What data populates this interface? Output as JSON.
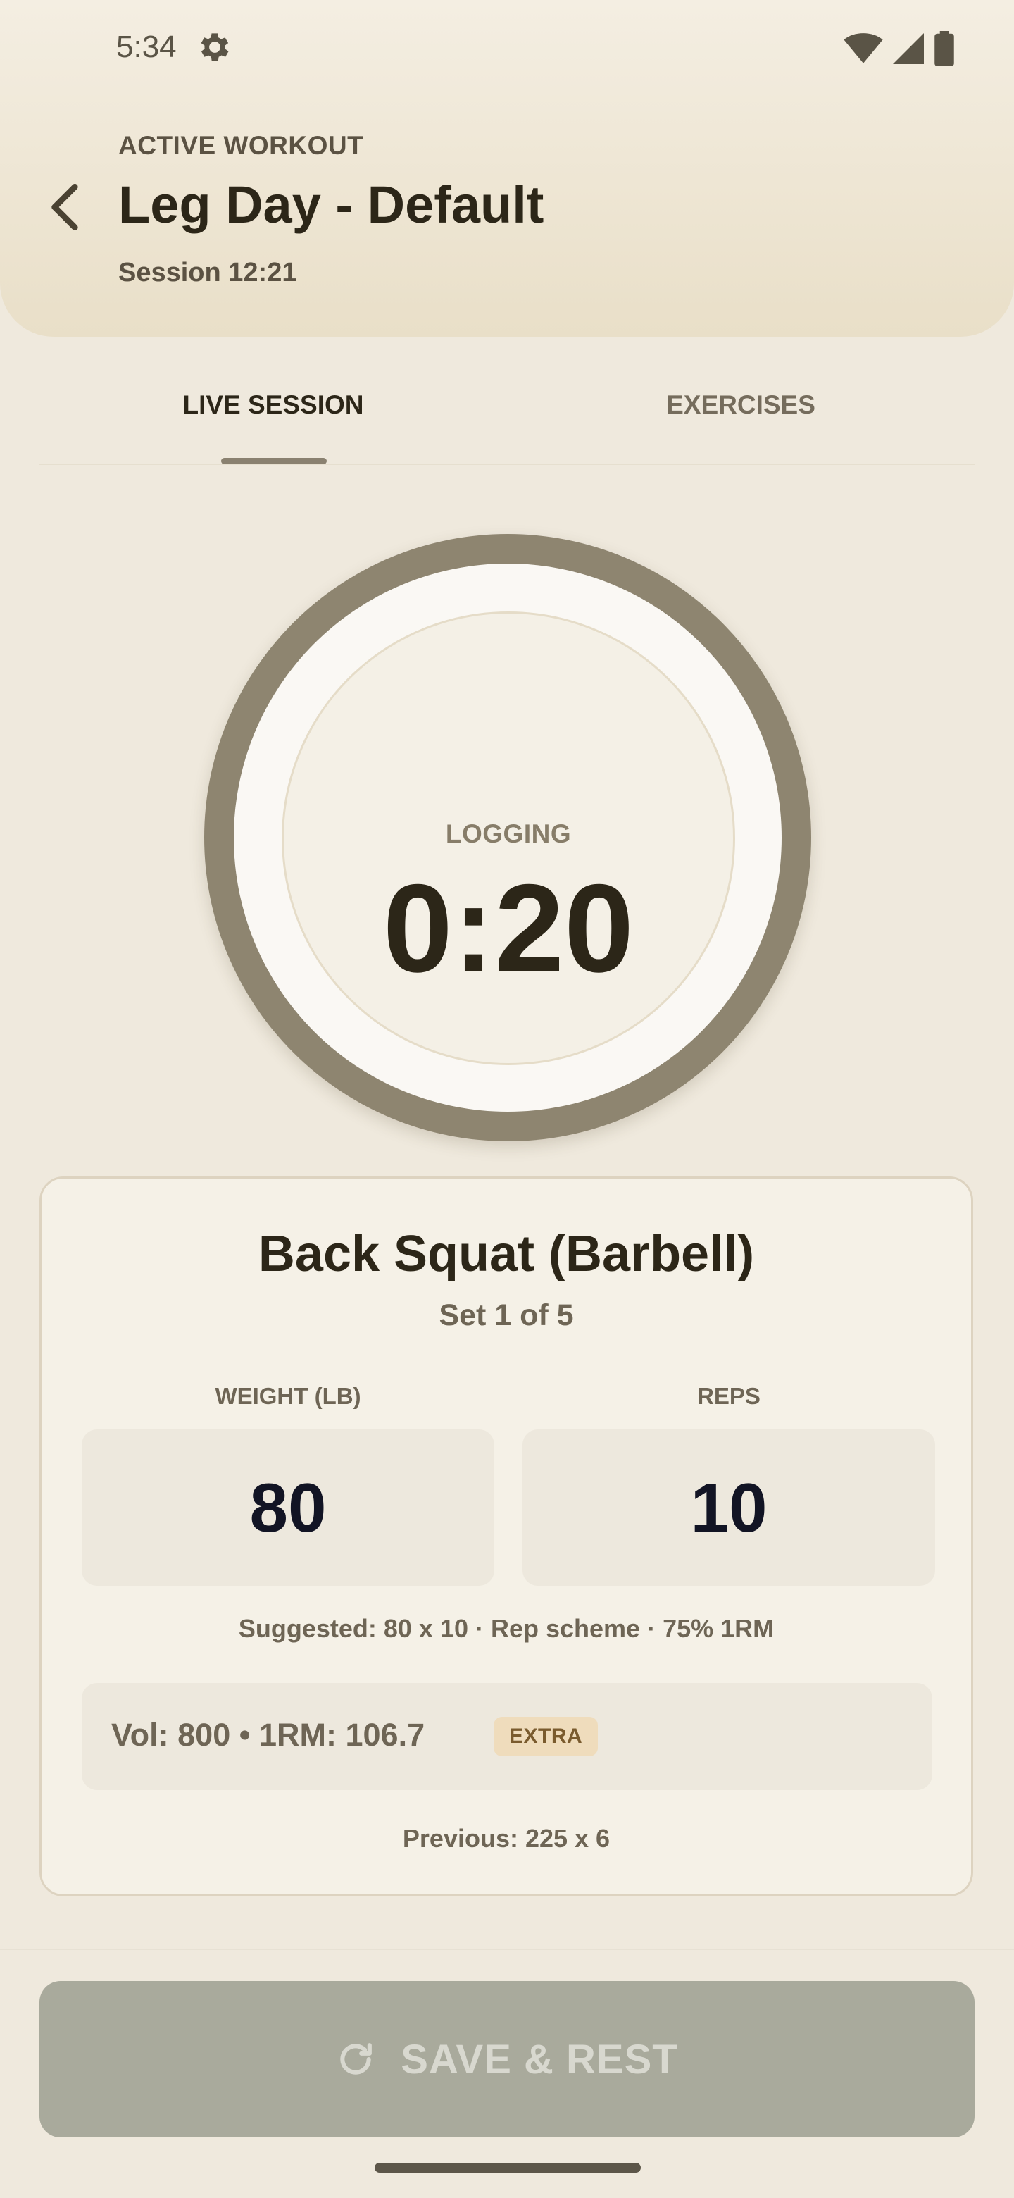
{
  "status_bar": {
    "time": "5:34",
    "icons": [
      "gear-icon",
      "wifi-icon",
      "signal-icon",
      "battery-icon"
    ]
  },
  "header": {
    "eyebrow": "ACTIVE WORKOUT",
    "title": "Leg Day - Default",
    "session": "Session 12:21",
    "back_icon": "chevron-left-icon"
  },
  "tabs": [
    {
      "label": "LIVE SESSION",
      "active": true
    },
    {
      "label": "EXERCISES",
      "active": false
    }
  ],
  "timer": {
    "label": "LOGGING",
    "value": "0:20"
  },
  "exercise": {
    "name": "Back Squat (Barbell)",
    "set_text": "Set 1 of 5",
    "weight_label": "WEIGHT (LB)",
    "weight_value": "80",
    "reps_label": "REPS",
    "reps_value": "10",
    "suggested": "Suggested: 80 x 10 · Rep scheme · 75% 1RM",
    "stats": "Vol: 800 • 1RM: 106.7",
    "badge": "EXTRA",
    "previous": "Previous: 225 x 6"
  },
  "actions": {
    "save_label": "SAVE & REST",
    "save_icon": "refresh-icon"
  },
  "colors": {
    "background": "#efe9dd",
    "ring": "#8e8570",
    "button_disabled": "#a9aa9c",
    "badge_bg": "#efdcbc",
    "badge_text": "#7a5b2e"
  }
}
